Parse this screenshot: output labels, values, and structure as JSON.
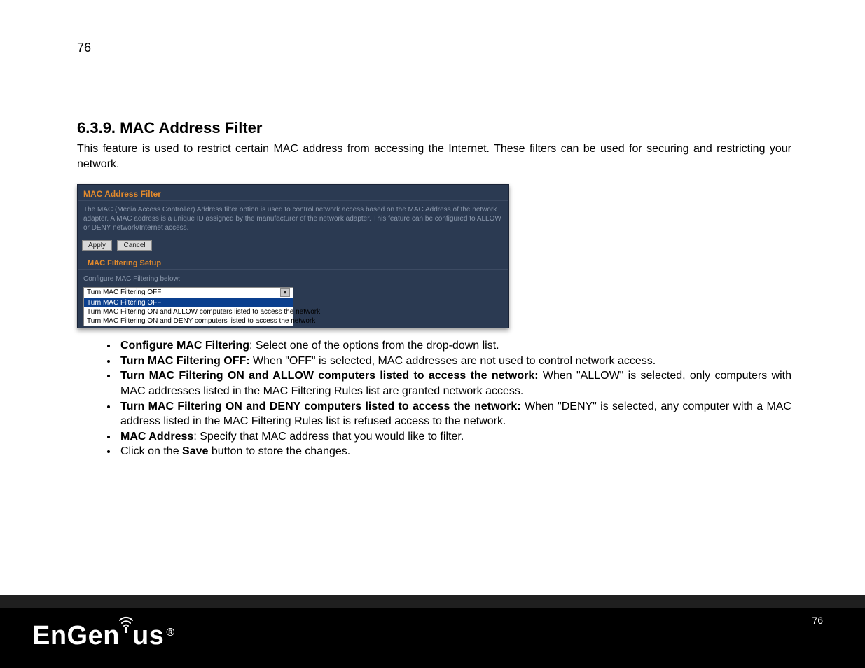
{
  "page_number_top": "76",
  "page_number_bottom": "76",
  "heading": "6.3.9. MAC Address Filter",
  "intro": "This feature is used to restrict certain MAC address from accessing the Internet. These filters can be used for securing and restricting your network.",
  "screenshot": {
    "title": "MAC Address Filter",
    "desc": "The MAC (Media Access Controller) Address filter option is used to control network access based on the MAC Address of the network adapter. A MAC address is a unique ID assigned by the manufacturer of the network adapter. This feature can be configured to ALLOW or DENY network/Internet access.",
    "apply_label": "Apply",
    "cancel_label": "Cancel",
    "subtitle": "MAC Filtering Setup",
    "config_label": "Configure MAC Filtering below:",
    "selected": "Turn MAC Filtering OFF",
    "options": {
      "o0": "Turn MAC Filtering OFF",
      "o1": "Turn MAC Filtering ON and ALLOW computers listed to access the network",
      "o2": "Turn MAC Filtering ON and DENY computers listed to access the network"
    }
  },
  "bullets": {
    "b0_bold": "Configure MAC Filtering",
    "b0_rest": ": Select one of the options from the drop-down list.",
    "b1_bold": "Turn MAC Filtering OFF:",
    "b1_rest": " When \"OFF\" is selected, MAC addresses are not used to control network access.",
    "b2_bold": "Turn MAC Filtering ON and ALLOW computers listed to access the network:",
    "b2_rest": " When \"ALLOW\" is selected, only computers with MAC addresses listed in the MAC Filtering Rules list are granted network access.",
    "b3_bold": "Turn MAC Filtering ON and DENY computers listed to access the network:",
    "b3_rest": " When \"DENY\" is selected, any computer with a MAC address listed in the MAC Filtering Rules list is refused access to the network.",
    "b4_bold": "MAC Address",
    "b4_rest": ": Specify that MAC address that you would like to filter.",
    "b5_pre": "Click on the ",
    "b5_bold": "Save",
    "b5_post": " button to store the changes."
  },
  "logo": {
    "part1": "EnGen",
    "part2": "us",
    "reg": "®"
  }
}
